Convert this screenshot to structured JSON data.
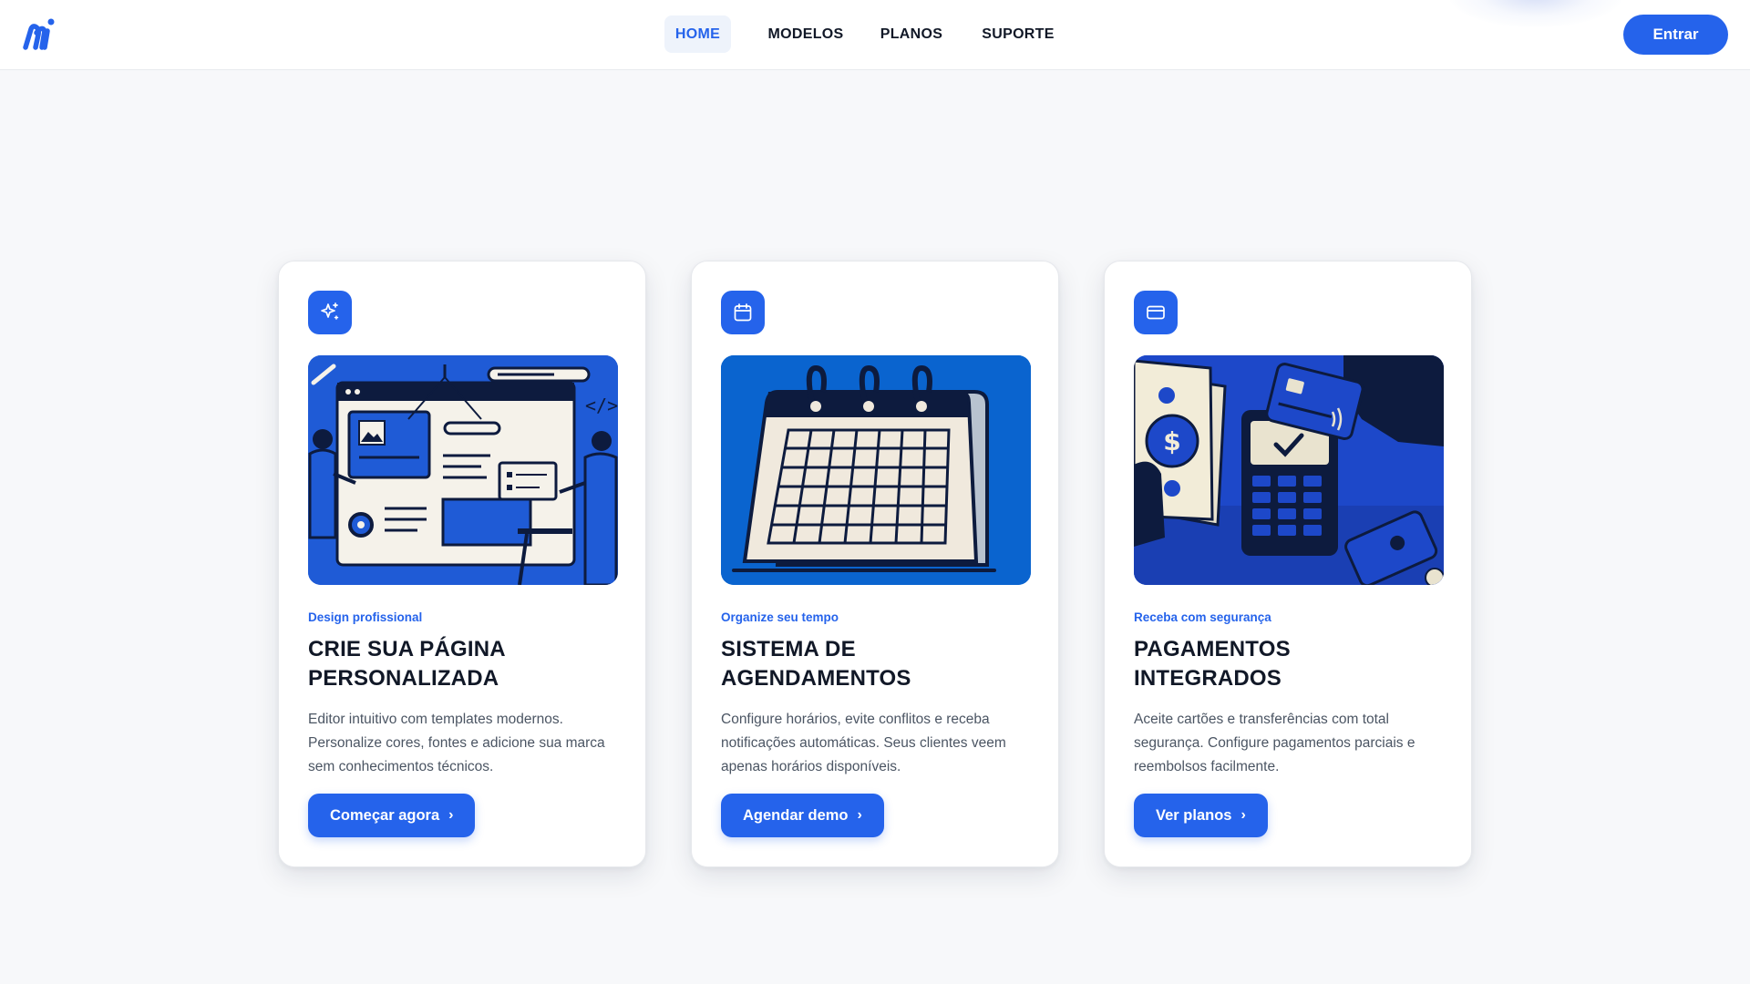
{
  "header": {
    "nav": [
      {
        "label": "HOME",
        "active": true
      },
      {
        "label": "MODELOS",
        "active": false
      },
      {
        "label": "PLANOS",
        "active": false
      },
      {
        "label": "SUPORTE",
        "active": false
      }
    ],
    "login_label": "Entrar"
  },
  "colors": {
    "accent": "#2563eb",
    "dark": "#111827",
    "muted": "#4b5563",
    "background": "#f7f8fa"
  },
  "cards": [
    {
      "icon": "sparkles-icon",
      "eyebrow": "Design profissional",
      "title": "CRIE SUA PÁGINA PERSONALIZADA",
      "description": "Editor intuitivo com templates modernos. Personalize cores, fontes e adicione sua marca sem conhecimentos técnicos.",
      "cta": "Começar agora"
    },
    {
      "icon": "calendar-icon",
      "eyebrow": "Organize seu tempo",
      "title": "SISTEMA DE AGENDAMENTOS",
      "description": "Configure horários, evite conflitos e receba notificações automáticas. Seus clientes veem apenas horários disponíveis.",
      "cta": "Agendar demo"
    },
    {
      "icon": "credit-card-icon",
      "eyebrow": "Receba com segurança",
      "title": "PAGAMENTOS INTEGRADOS",
      "description": "Aceite cartões e transferências com total segurança. Configure pagamentos parciais e reembolsos facilmente.",
      "cta": "Ver planos"
    }
  ]
}
